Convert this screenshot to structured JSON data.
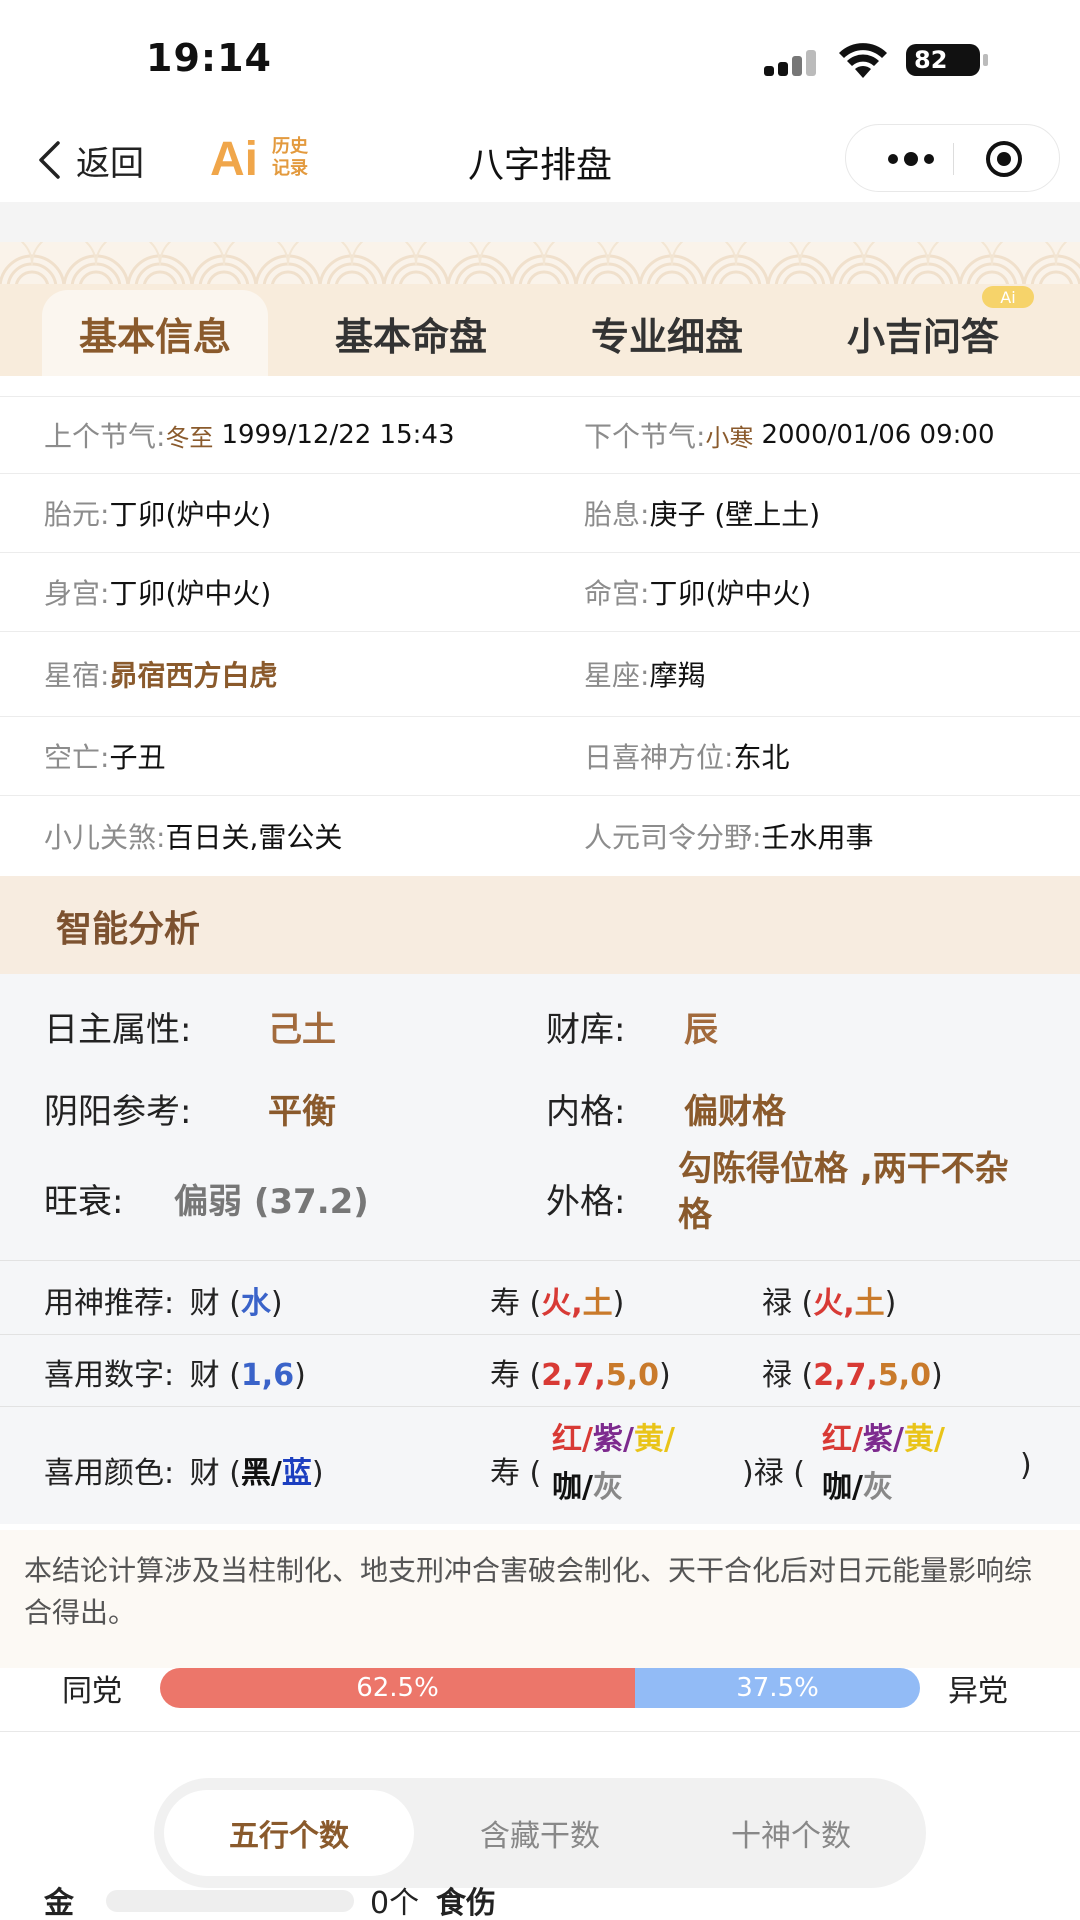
{
  "status": {
    "time": "19:14",
    "battery": "82"
  },
  "nav": {
    "back_label": "返回",
    "logo_text": "Ai",
    "logo_sub1": "历史",
    "logo_sub2": "记录",
    "title": "八字排盘"
  },
  "tabs": [
    {
      "label": "基本信息",
      "active": true
    },
    {
      "label": "基本命盘",
      "active": false
    },
    {
      "label": "专业细盘",
      "active": false
    },
    {
      "label": "小吉问答",
      "active": false
    }
  ],
  "tab_badge": "Ai",
  "info": {
    "prev_term_label": "上个节气:",
    "prev_term_name": "冬至",
    "prev_term_time": "1999/12/22 15:43",
    "next_term_label": "下个节气:",
    "next_term_name": "小寒",
    "next_term_time": "2000/01/06 09:00",
    "rows": [
      {
        "l_label": "胎元:",
        "l_value": "丁卯(炉中火)",
        "r_label": "胎息:",
        "r_value": "庚子 (壁上土)"
      },
      {
        "l_label": "身宫:",
        "l_value": "丁卯(炉中火)",
        "r_label": "命宫:",
        "r_value": "丁卯(炉中火)"
      },
      {
        "l_label": "星宿:",
        "l_value": "昴宿西方白虎",
        "r_label": "星座:",
        "r_value": "摩羯"
      },
      {
        "l_label": "空亡:",
        "l_value": "子丑",
        "r_label": "日喜神方位:",
        "r_value": "东北"
      },
      {
        "l_label": "小儿关煞:",
        "l_value": "百日关,雷公关",
        "r_label": "人元司令分野:",
        "r_value": "壬水用事"
      }
    ]
  },
  "analysis": {
    "title": "智能分析",
    "day_master_label": "日主属性:",
    "day_master_value": "己土",
    "treasury_label": "财库:",
    "treasury_value": "辰",
    "yinyang_label": "阴阳参考:",
    "yinyang_value": "平衡",
    "inner_label": "内格:",
    "inner_value": "偏财格",
    "strength_label": "旺衰:",
    "strength_value": "偏弱 (37.2)",
    "outer_label": "外格:",
    "outer_value": "勾陈得位格 ,两干不杂格"
  },
  "recommend": {
    "god_label": "用神推荐:",
    "number_label": "喜用数字:",
    "color_label": "喜用颜色:",
    "cai": "财",
    "shou": "寿",
    "lu": "禄",
    "god_cai": "水",
    "god_shou_a": "火",
    "god_shou_b": "土",
    "god_lu_a": "火",
    "god_lu_b": "土",
    "num_cai_a": "1",
    "num_cai_b": "6",
    "num_x_a": "2",
    "num_x_b": "7",
    "num_x_c": "5",
    "num_x_d": "0",
    "col_cai_a": "黑",
    "col_cai_b": "蓝",
    "col_a": "红",
    "col_b": "紫",
    "col_c": "黄",
    "col_d": "咖",
    "col_e": "灰"
  },
  "note": "本结论计算涉及当柱制化、地支刑冲合害破会制化、天干合化后对日元能量影响综合得出。",
  "party": {
    "same_label": "同党",
    "diff_label": "异党",
    "same_pct": 62.5,
    "diff_pct": 37.5,
    "same_text": "62.5%",
    "diff_text": "37.5%"
  },
  "segments": [
    {
      "label": "五行个数",
      "active": true
    },
    {
      "label": "含藏干数",
      "active": false
    },
    {
      "label": "十神个数",
      "active": false
    }
  ],
  "five_elements": [
    {
      "name": "金",
      "count": "0个",
      "god": "食伤",
      "fill": 0
    }
  ],
  "colors": {
    "brown": "#8a5a2c",
    "tab_bg": "#f8ecdc",
    "same": "#ec766a",
    "diff": "#92bbf6"
  }
}
